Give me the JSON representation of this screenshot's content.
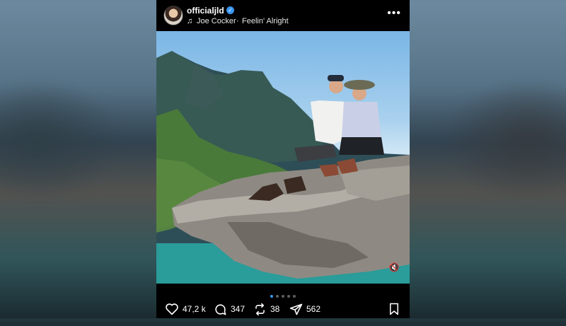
{
  "post": {
    "username": "officialjld",
    "music": {
      "artist": "Joe Cocker",
      "separator": "·",
      "song": "Feelin' Alright"
    },
    "icons": {
      "verified": "verified-badge-icon",
      "music": "music-note-icon",
      "more": "more-options-icon",
      "mute": "speaker-muted-icon"
    },
    "carousel": {
      "total": 5,
      "active_index": 0
    },
    "actions": {
      "likes": "47,2 k",
      "comments": "347",
      "reposts": "38",
      "shares": "562"
    }
  },
  "colors": {
    "accent": "#3897f0",
    "background": "#000000"
  }
}
